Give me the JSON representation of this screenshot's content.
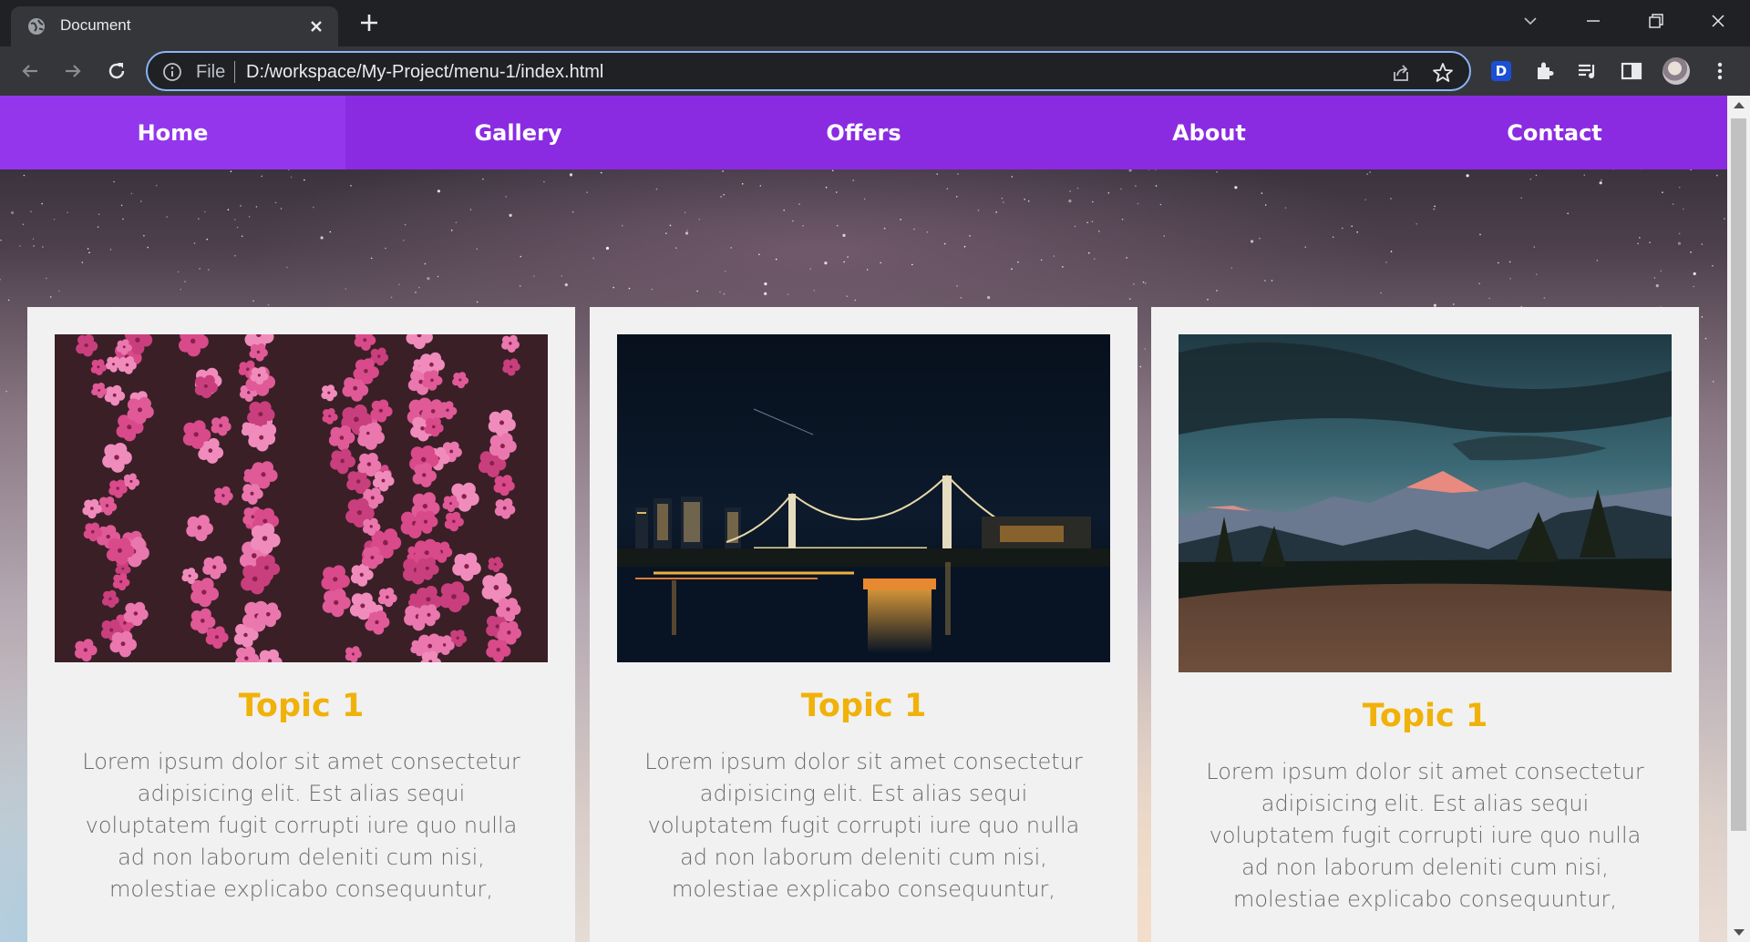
{
  "browser": {
    "tab_title": "Document",
    "omnibox_scheme": "File",
    "url": "D:/workspace/My-Project/menu-1/index.html",
    "extension_badge": "D"
  },
  "nav": {
    "items": [
      {
        "label": "Home",
        "active": true
      },
      {
        "label": "Gallery"
      },
      {
        "label": "Offers"
      },
      {
        "label": "About"
      },
      {
        "label": "Contact"
      }
    ]
  },
  "cards": [
    {
      "image": "pink-flowers-photo",
      "title": "Topic 1",
      "text": "Lorem ipsum dolor sit amet consectetur adipisicing elit. Est alias sequi voluptatem fugit corrupti iure quo nulla ad non laborum deleniti cum nisi, molestiae explicabo consequuntur,"
    },
    {
      "image": "night-city-bridge-photo",
      "title": "Topic 1",
      "text": "Lorem ipsum dolor sit amet consectetur adipisicing elit. Est alias sequi voluptatem fugit corrupti iure quo nulla ad non laborum deleniti cum nisi, molestiae explicabo consequuntur,"
    },
    {
      "image": "mountain-sunset-photo",
      "title": "Topic 1",
      "text": "Lorem ipsum dolor sit amet consectetur adipisicing elit. Est alias sequi voluptatem fugit corrupti iure quo nulla ad non laborum deleniti cum nisi, molestiae explicabo consequuntur,"
    }
  ],
  "colors": {
    "nav_bg": "#8a2be2",
    "card_bg": "#f2f1f1",
    "title_color": "#f0b20a",
    "text_color": "#6a6a6a",
    "omnibox_border": "#8ab4f8"
  }
}
